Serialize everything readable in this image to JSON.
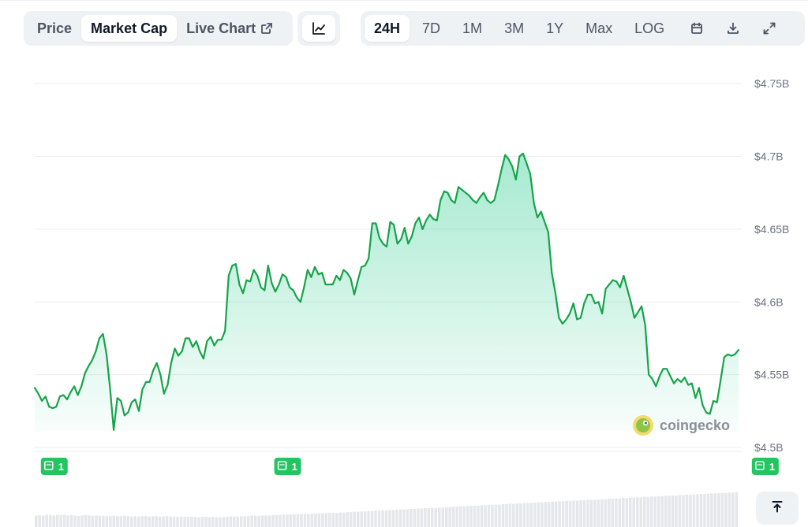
{
  "toolbar": {
    "views": [
      {
        "label": "Price",
        "active": false
      },
      {
        "label": "Market Cap",
        "active": true
      },
      {
        "label": "Live Chart",
        "active": false,
        "icon": "external-link-icon"
      }
    ],
    "chart_type_icon": "line-chart-icon",
    "ranges": [
      {
        "label": "24H",
        "active": true
      },
      {
        "label": "7D",
        "active": false
      },
      {
        "label": "1M",
        "active": false
      },
      {
        "label": "3M",
        "active": false
      },
      {
        "label": "1Y",
        "active": false
      },
      {
        "label": "Max",
        "active": false
      },
      {
        "label": "LOG",
        "active": false
      }
    ],
    "action_icons": [
      "calendar-icon",
      "download-icon",
      "expand-icon"
    ]
  },
  "watermark": {
    "text": "coingecko",
    "icon": "gecko-logo-icon"
  },
  "scroll_top_icon": "arrow-up-to-line-icon",
  "colors": {
    "line": "#16a34a",
    "fill_top": "#16c784",
    "badge": "#22c55e",
    "grid": "#eceef1",
    "volume": "#e5e7eb"
  },
  "chart_data": {
    "type": "area",
    "currency_prefix": "$",
    "y_unit": "B",
    "yticks": [
      4.5,
      4.55,
      4.6,
      4.65,
      4.7,
      4.75
    ],
    "ytick_labels": [
      "$4.5B",
      "$4.55B",
      "$4.6B",
      "$4.65B",
      "$4.7B",
      "$4.75B"
    ],
    "ylim": [
      4.5,
      4.775
    ],
    "grid": true,
    "values": [
      4.541,
      4.537,
      4.532,
      4.535,
      4.528,
      4.527,
      4.528,
      4.535,
      4.536,
      4.533,
      4.538,
      4.542,
      4.536,
      4.542,
      4.551,
      4.556,
      4.56,
      4.566,
      4.575,
      4.578,
      4.564,
      4.54,
      4.512,
      4.534,
      4.532,
      4.522,
      4.524,
      4.531,
      4.533,
      4.525,
      4.54,
      4.545,
      4.545,
      4.553,
      4.558,
      4.55,
      4.537,
      4.543,
      4.558,
      4.568,
      4.563,
      4.566,
      4.575,
      4.575,
      4.569,
      4.573,
      4.566,
      4.561,
      4.573,
      4.576,
      4.57,
      4.574,
      4.574,
      4.58,
      4.618,
      4.625,
      4.626,
      4.612,
      4.606,
      4.615,
      4.614,
      4.622,
      4.618,
      4.61,
      4.608,
      4.625,
      4.613,
      4.607,
      4.612,
      4.619,
      4.617,
      4.61,
      4.608,
      4.603,
      4.6,
      4.61,
      4.622,
      4.617,
      4.624,
      4.619,
      4.62,
      4.612,
      4.612,
      4.612,
      4.618,
      4.615,
      4.622,
      4.62,
      4.616,
      4.605,
      4.615,
      4.624,
      4.625,
      4.63,
      4.654,
      4.654,
      4.644,
      4.64,
      4.638,
      4.655,
      4.653,
      4.64,
      4.643,
      4.651,
      4.64,
      4.645,
      4.654,
      4.658,
      4.65,
      4.656,
      4.66,
      4.657,
      4.656,
      4.67,
      4.676,
      4.675,
      4.67,
      4.668,
      4.679,
      4.677,
      4.675,
      4.673,
      4.67,
      4.668,
      4.672,
      4.675,
      4.67,
      4.668,
      4.67,
      4.68,
      4.691,
      4.701,
      4.698,
      4.693,
      4.684,
      4.7,
      4.702,
      4.695,
      4.688,
      4.668,
      4.658,
      4.662,
      4.655,
      4.648,
      4.62,
      4.606,
      4.589,
      4.585,
      4.588,
      4.592,
      4.599,
      4.588,
      4.589,
      4.599,
      4.605,
      4.605,
      4.599,
      4.6,
      4.592,
      4.609,
      4.612,
      4.615,
      4.614,
      4.61,
      4.618,
      4.609,
      4.6,
      4.589,
      4.593,
      4.597,
      4.584,
      4.55,
      4.547,
      4.542,
      4.549,
      4.554,
      4.554,
      4.549,
      4.544,
      4.547,
      4.545,
      4.548,
      4.543,
      4.544,
      4.534,
      4.541,
      4.529,
      4.524,
      4.523,
      4.532,
      4.531,
      4.546,
      4.562,
      4.564,
      4.563,
      4.564,
      4.567
    ],
    "volume": [
      0.32,
      0.33,
      0.32,
      0.34,
      0.33,
      0.32,
      0.33,
      0.33,
      0.34,
      0.32,
      0.33,
      0.32,
      0.31,
      0.32,
      0.33,
      0.32,
      0.31,
      0.32,
      0.31,
      0.31,
      0.3,
      0.3,
      0.31,
      0.3,
      0.3,
      0.31,
      0.3,
      0.29,
      0.3,
      0.29,
      0.3,
      0.3,
      0.29,
      0.3,
      0.3,
      0.29,
      0.29,
      0.3,
      0.29,
      0.29,
      0.28,
      0.29,
      0.28,
      0.28,
      0.28,
      0.28,
      0.27,
      0.28,
      0.28,
      0.27,
      0.28,
      0.27,
      0.27,
      0.27,
      0.28,
      0.29,
      0.29,
      0.29,
      0.3,
      0.3,
      0.3,
      0.31,
      0.31,
      0.31,
      0.32,
      0.32,
      0.32,
      0.33,
      0.33,
      0.33,
      0.34,
      0.34,
      0.35,
      0.35,
      0.35,
      0.36,
      0.36,
      0.36,
      0.37,
      0.37,
      0.38,
      0.38,
      0.38,
      0.39,
      0.39,
      0.39,
      0.4,
      0.4,
      0.41,
      0.41,
      0.42,
      0.42,
      0.43,
      0.43,
      0.44,
      0.44,
      0.45,
      0.45,
      0.46,
      0.46,
      0.47,
      0.47,
      0.48,
      0.48,
      0.49,
      0.49,
      0.5,
      0.5,
      0.51,
      0.51,
      0.52,
      0.52,
      0.53,
      0.53,
      0.54,
      0.54,
      0.55,
      0.55,
      0.56,
      0.56,
      0.57,
      0.57,
      0.58,
      0.58,
      0.59,
      0.59,
      0.6,
      0.6,
      0.61,
      0.61,
      0.62,
      0.62,
      0.63,
      0.63,
      0.64,
      0.64,
      0.65,
      0.65,
      0.66,
      0.66,
      0.67,
      0.67,
      0.68,
      0.68,
      0.69,
      0.69,
      0.7,
      0.7,
      0.71,
      0.71,
      0.72,
      0.72,
      0.73,
      0.73,
      0.74,
      0.74,
      0.75,
      0.75,
      0.76,
      0.76,
      0.77,
      0.77,
      0.78,
      0.78,
      0.79,
      0.79,
      0.8,
      0.8,
      0.81,
      0.81,
      0.82,
      0.82,
      0.83,
      0.83,
      0.84,
      0.84,
      0.85,
      0.85,
      0.86,
      0.86,
      0.87,
      0.87,
      0.88,
      0.88,
      0.89,
      0.89,
      0.9,
      0.9,
      0.91,
      0.91,
      0.92,
      0.92,
      0.93,
      0.93,
      0.94,
      0.94,
      0.95,
      0.95,
      0.96
    ],
    "events": [
      {
        "index": 5,
        "count": "1"
      },
      {
        "index": 70,
        "count": "1"
      },
      {
        "index": 203,
        "count": "1"
      }
    ]
  }
}
